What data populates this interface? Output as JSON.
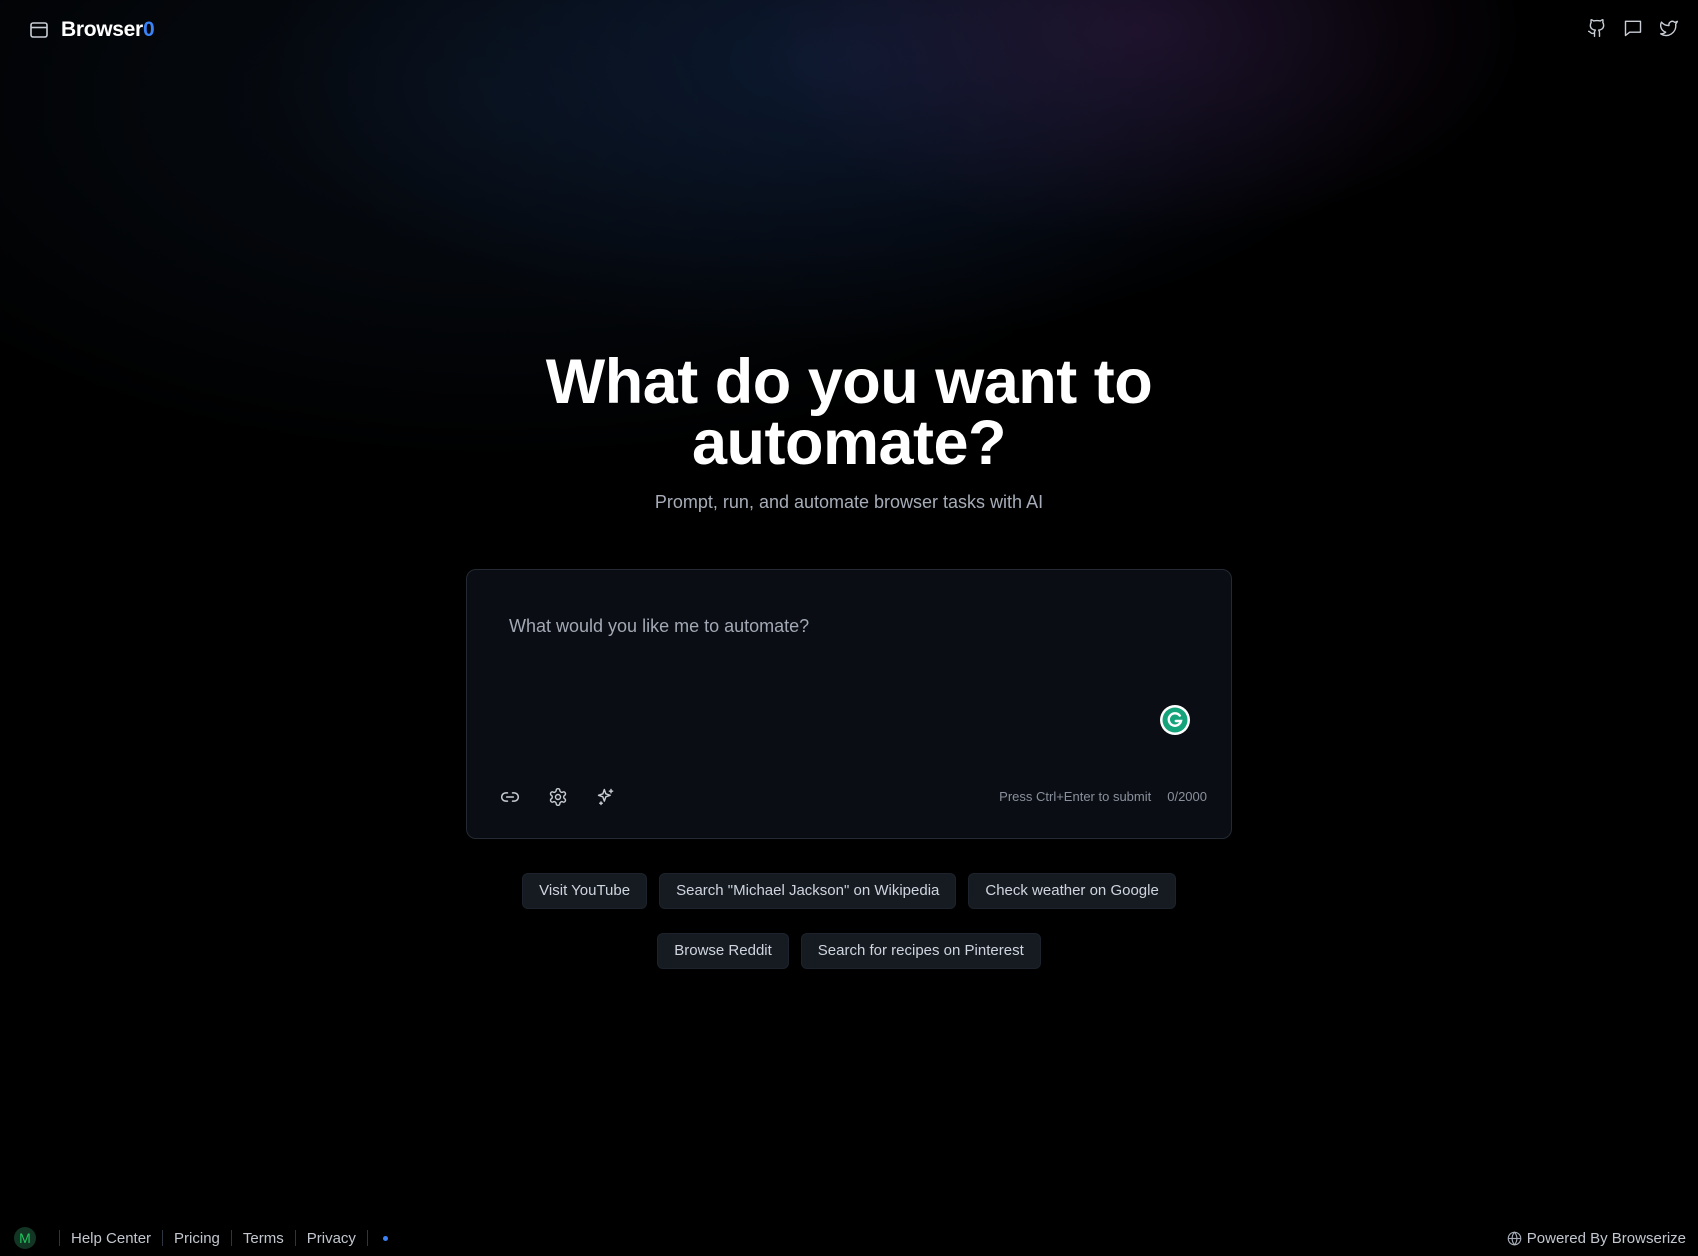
{
  "header": {
    "brand_prefix": "Browser",
    "brand_suffix": "0",
    "icons": [
      "sidebar-icon",
      "github-icon",
      "chat-icon",
      "twitter-icon"
    ]
  },
  "hero": {
    "title": "What do you want to automate?",
    "subtitle": "Prompt, run, and automate browser tasks with AI"
  },
  "prompt": {
    "placeholder": "What would you like me to automate?",
    "value": "",
    "tools": [
      "link-icon",
      "settings-icon",
      "sparkles-icon"
    ],
    "hint": "Press Ctrl+Enter to submit",
    "counter": "0/2000"
  },
  "suggestions": {
    "row1": [
      "Visit YouTube",
      "Search \"Michael Jackson\" on Wikipedia",
      "Check weather on Google"
    ],
    "row2": [
      "Browse Reddit",
      "Search for recipes on Pinterest"
    ]
  },
  "footer": {
    "avatar_initial": "M",
    "links": [
      "Help Center",
      "Pricing",
      "Terms",
      "Privacy"
    ],
    "powered_by": "Powered By Browserize"
  },
  "colors": {
    "background": "#000000",
    "accent": "#3b82f6",
    "chip_bg": "#161b22",
    "avatar_text": "#22c55e"
  }
}
